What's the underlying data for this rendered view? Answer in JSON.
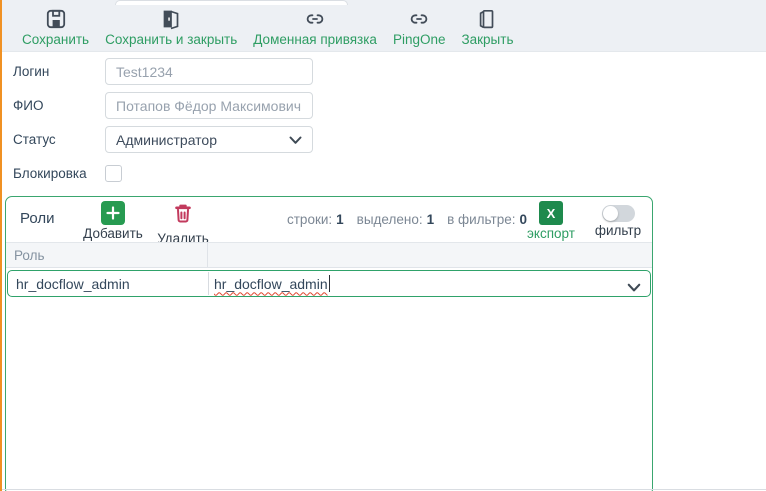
{
  "toolbar": {
    "save_label": "Сохранить",
    "save_close_label": "Сохранить и закрыть",
    "domain_binding_label": "Доменная привязка",
    "pingone_label": "PingOne",
    "close_label": "Закрыть"
  },
  "form": {
    "login_label": "Логин",
    "login_value": "Test1234",
    "fio_label": "ФИО",
    "fio_value": "Потапов Фёдор Максимович",
    "status_label": "Статус",
    "status_value": "Администратор",
    "block_label": "Блокировка",
    "block_checked": false
  },
  "roles": {
    "title": "Роли",
    "add_label": "Добавить",
    "delete_label": "Удалить",
    "rows_label": "строки:",
    "rows_value": "1",
    "selected_label": "выделено:",
    "selected_value": "1",
    "filtered_label": "в фильтре:",
    "filtered_value": "0",
    "export_label": "экспорт",
    "export_icon_letter": "X",
    "filter_label": "фильтр",
    "filter_on": false,
    "column_header": "Роль",
    "row_cell_text": "hr_docflow_admin",
    "editor_text": "hr_docflow_admin"
  },
  "colors": {
    "accent_green": "#2e9d63",
    "panel_border_green": "#3aa66f",
    "row_border_green": "#2fa26a",
    "add_button_green": "#279b51",
    "export_button_green": "#1e8a4d",
    "delete_icon_red": "#c23a5d",
    "edge_orange": "#f09123",
    "toolbar_bg": "#edf0f4",
    "spellcheck_red": "#e0442c"
  }
}
